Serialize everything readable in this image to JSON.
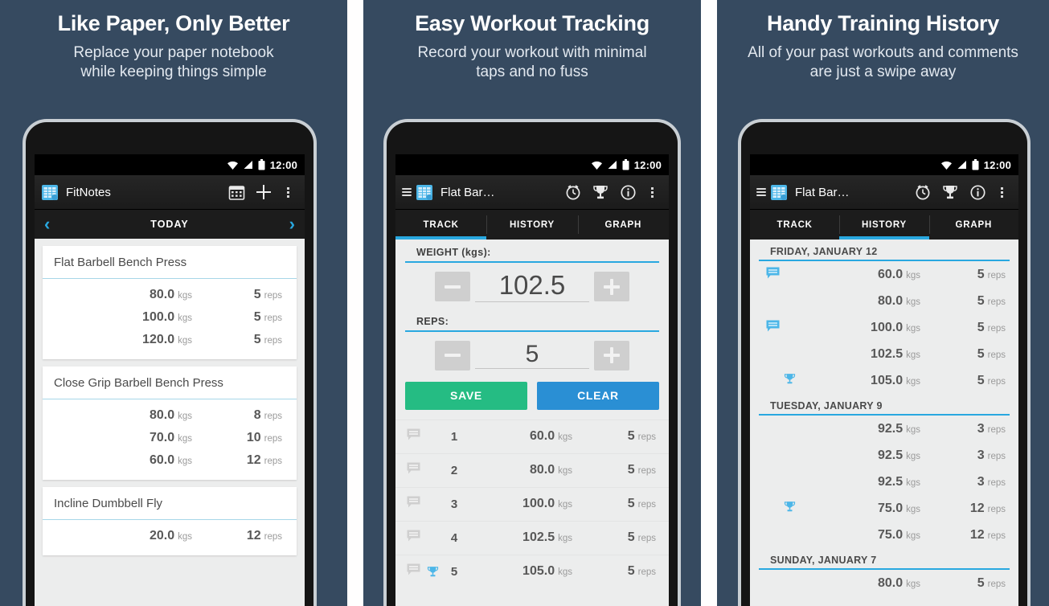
{
  "theme": {
    "bg": "#364a60",
    "accent": "#29a8e0",
    "save_green": "#25bc83",
    "clear_blue": "#2a8fd4"
  },
  "panels": [
    {
      "id": "panel-1",
      "title": "Like Paper, Only Better",
      "subtitle": "Replace your paper notebook\nwhile keeping things simple",
      "statusbar": {
        "time": "12:00",
        "icons": [
          "wifi-icon",
          "signal-icon",
          "battery-icon"
        ]
      },
      "actionbar": {
        "app_title": "FitNotes",
        "logo": "fitnotes-logo-icon",
        "icons": [
          "calendar-icon",
          "plus-icon",
          "overflow-menu-icon"
        ]
      },
      "datebar": {
        "prev": "‹",
        "label": "TODAY",
        "next": "›"
      },
      "cards": [
        {
          "name": "Flat Barbell Bench Press",
          "sets": [
            {
              "weight": "80.0",
              "weight_unit": "kgs",
              "reps": "5",
              "reps_unit": "reps"
            },
            {
              "weight": "100.0",
              "weight_unit": "kgs",
              "reps": "5",
              "reps_unit": "reps"
            },
            {
              "weight": "120.0",
              "weight_unit": "kgs",
              "reps": "5",
              "reps_unit": "reps"
            }
          ]
        },
        {
          "name": "Close Grip Barbell Bench Press",
          "sets": [
            {
              "weight": "80.0",
              "weight_unit": "kgs",
              "reps": "8",
              "reps_unit": "reps"
            },
            {
              "weight": "70.0",
              "weight_unit": "kgs",
              "reps": "10",
              "reps_unit": "reps"
            },
            {
              "weight": "60.0",
              "weight_unit": "kgs",
              "reps": "12",
              "reps_unit": "reps"
            }
          ]
        },
        {
          "name": "Incline Dumbbell Fly",
          "sets": [
            {
              "weight": "20.0",
              "weight_unit": "kgs",
              "reps": "12",
              "reps_unit": "reps"
            }
          ]
        }
      ]
    },
    {
      "id": "panel-2",
      "title": "Easy Workout Tracking",
      "subtitle": "Record your workout with minimal\ntaps and no fuss",
      "statusbar": {
        "time": "12:00",
        "icons": [
          "wifi-icon",
          "signal-icon",
          "battery-icon"
        ]
      },
      "actionbar": {
        "app_title": "Flat Bar…",
        "logo": "fitnotes-logo-icon",
        "icons": [
          "hamburger-icon",
          "timer-icon",
          "trophy-icon",
          "info-icon",
          "overflow-menu-icon"
        ]
      },
      "tabs": [
        {
          "label": "TRACK",
          "active": true
        },
        {
          "label": "HISTORY",
          "active": false
        },
        {
          "label": "GRAPH",
          "active": false
        }
      ],
      "form": {
        "weight_label": "WEIGHT (kgs):",
        "weight_value": "102.5",
        "reps_label": "REPS:",
        "reps_value": "5",
        "minus": "minus-icon",
        "plus": "plus-icon",
        "save_label": "SAVE",
        "clear_label": "CLEAR"
      },
      "log": [
        {
          "index": "1",
          "note": true,
          "trophy": false,
          "weight": "60.0",
          "weight_unit": "kgs",
          "reps": "5",
          "reps_unit": "reps"
        },
        {
          "index": "2",
          "note": true,
          "trophy": false,
          "weight": "80.0",
          "weight_unit": "kgs",
          "reps": "5",
          "reps_unit": "reps"
        },
        {
          "index": "3",
          "note": true,
          "trophy": false,
          "weight": "100.0",
          "weight_unit": "kgs",
          "reps": "5",
          "reps_unit": "reps"
        },
        {
          "index": "4",
          "note": true,
          "trophy": false,
          "weight": "102.5",
          "weight_unit": "kgs",
          "reps": "5",
          "reps_unit": "reps"
        },
        {
          "index": "5",
          "note": true,
          "trophy": true,
          "weight": "105.0",
          "weight_unit": "kgs",
          "reps": "5",
          "reps_unit": "reps"
        }
      ]
    },
    {
      "id": "panel-3",
      "title": "Handy Training History",
      "subtitle": "All of your past workouts and comments\nare just a swipe away",
      "statusbar": {
        "time": "12:00",
        "icons": [
          "wifi-icon",
          "signal-icon",
          "battery-icon"
        ]
      },
      "actionbar": {
        "app_title": "Flat Bar…",
        "logo": "fitnotes-logo-icon",
        "icons": [
          "hamburger-icon",
          "timer-icon",
          "trophy-icon",
          "info-icon",
          "overflow-menu-icon"
        ]
      },
      "tabs": [
        {
          "label": "TRACK",
          "active": false
        },
        {
          "label": "HISTORY",
          "active": true
        },
        {
          "label": "GRAPH",
          "active": false
        }
      ],
      "history": [
        {
          "date": "FRIDAY, JANUARY 12",
          "rows": [
            {
              "note": true,
              "trophy": false,
              "weight": "60.0",
              "weight_unit": "kgs",
              "reps": "5",
              "reps_unit": "reps"
            },
            {
              "note": false,
              "trophy": false,
              "weight": "80.0",
              "weight_unit": "kgs",
              "reps": "5",
              "reps_unit": "reps"
            },
            {
              "note": true,
              "trophy": false,
              "weight": "100.0",
              "weight_unit": "kgs",
              "reps": "5",
              "reps_unit": "reps"
            },
            {
              "note": false,
              "trophy": false,
              "weight": "102.5",
              "weight_unit": "kgs",
              "reps": "5",
              "reps_unit": "reps"
            },
            {
              "note": false,
              "trophy": true,
              "weight": "105.0",
              "weight_unit": "kgs",
              "reps": "5",
              "reps_unit": "reps"
            }
          ]
        },
        {
          "date": "TUESDAY, JANUARY 9",
          "rows": [
            {
              "note": false,
              "trophy": false,
              "weight": "92.5",
              "weight_unit": "kgs",
              "reps": "3",
              "reps_unit": "reps"
            },
            {
              "note": false,
              "trophy": false,
              "weight": "92.5",
              "weight_unit": "kgs",
              "reps": "3",
              "reps_unit": "reps"
            },
            {
              "note": false,
              "trophy": false,
              "weight": "92.5",
              "weight_unit": "kgs",
              "reps": "3",
              "reps_unit": "reps"
            },
            {
              "note": false,
              "trophy": true,
              "weight": "75.0",
              "weight_unit": "kgs",
              "reps": "12",
              "reps_unit": "reps"
            },
            {
              "note": false,
              "trophy": false,
              "weight": "75.0",
              "weight_unit": "kgs",
              "reps": "12",
              "reps_unit": "reps"
            }
          ]
        },
        {
          "date": "SUNDAY, JANUARY 7",
          "rows": [
            {
              "note": false,
              "trophy": false,
              "weight": "80.0",
              "weight_unit": "kgs",
              "reps": "5",
              "reps_unit": "reps"
            }
          ]
        }
      ]
    }
  ]
}
